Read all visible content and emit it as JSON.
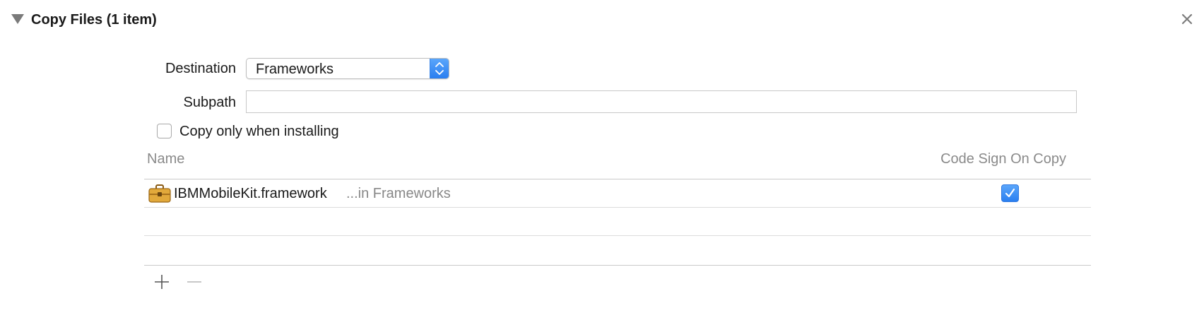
{
  "section": {
    "title": "Copy Files (1 item)",
    "disclosure_icon": "disclosure-triangle-down-icon",
    "close_icon": "close-icon"
  },
  "form": {
    "destination_label": "Destination",
    "destination_value": "Frameworks",
    "subpath_label": "Subpath",
    "subpath_value": "",
    "copy_only_label": "Copy only when installing",
    "copy_only_checked": false
  },
  "table": {
    "columns": [
      "Name",
      "Code Sign On Copy"
    ],
    "rows": [
      {
        "icon": "framework-toolbox-icon",
        "name": "IBMMobileKit.framework",
        "location": "...in Frameworks",
        "code_sign_on_copy": true
      }
    ]
  },
  "toolbar": {
    "add_icon": "plus-icon",
    "remove_icon": "minus-icon"
  },
  "colors": {
    "accent": "#3b8ef6",
    "muted_text": "#8a8a8a",
    "framework_icon": "#e2a93b"
  }
}
